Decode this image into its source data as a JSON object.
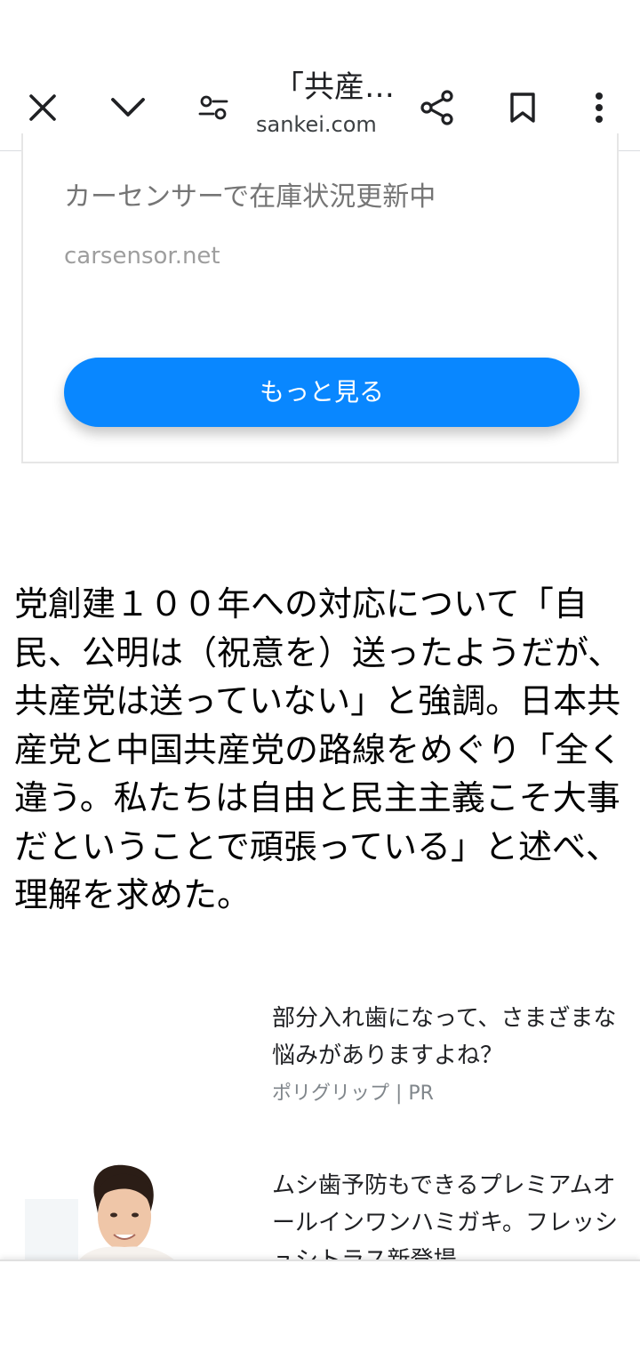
{
  "toolbar": {
    "title": "「共産…",
    "url": "sankei.com"
  },
  "ad": {
    "headline": "カーセンサーで在庫状況更新中",
    "domain": "carsensor.net",
    "cta_label": "もっと見る",
    "cta_color": "#0987ff"
  },
  "article": {
    "paragraph": "党創建１００年への対応について「自民、公明は（祝意を）送ったようだが、共産党は送っていない」と強調。日本共産党と中国共産党の路線をめぐり「全く違う。私たちは自由と民主主義こそ大事だということで頑張っている」と述べ、理解を求めた。"
  },
  "sponsored": [
    {
      "text": "部分入れ歯になって、さまざまな悩みがありますよね？",
      "source": "ポリグリップ | PR"
    },
    {
      "text": "ムシ歯予防もできるプレミアムオールインワンハミガキ。フレッシュシトラス新登場。"
    }
  ],
  "icons": {
    "close": "close-icon",
    "chevron": "chevron-down-icon",
    "tune": "tune-icon",
    "share": "share-icon",
    "bookmark": "bookmark-icon",
    "more": "more-vert-icon"
  }
}
